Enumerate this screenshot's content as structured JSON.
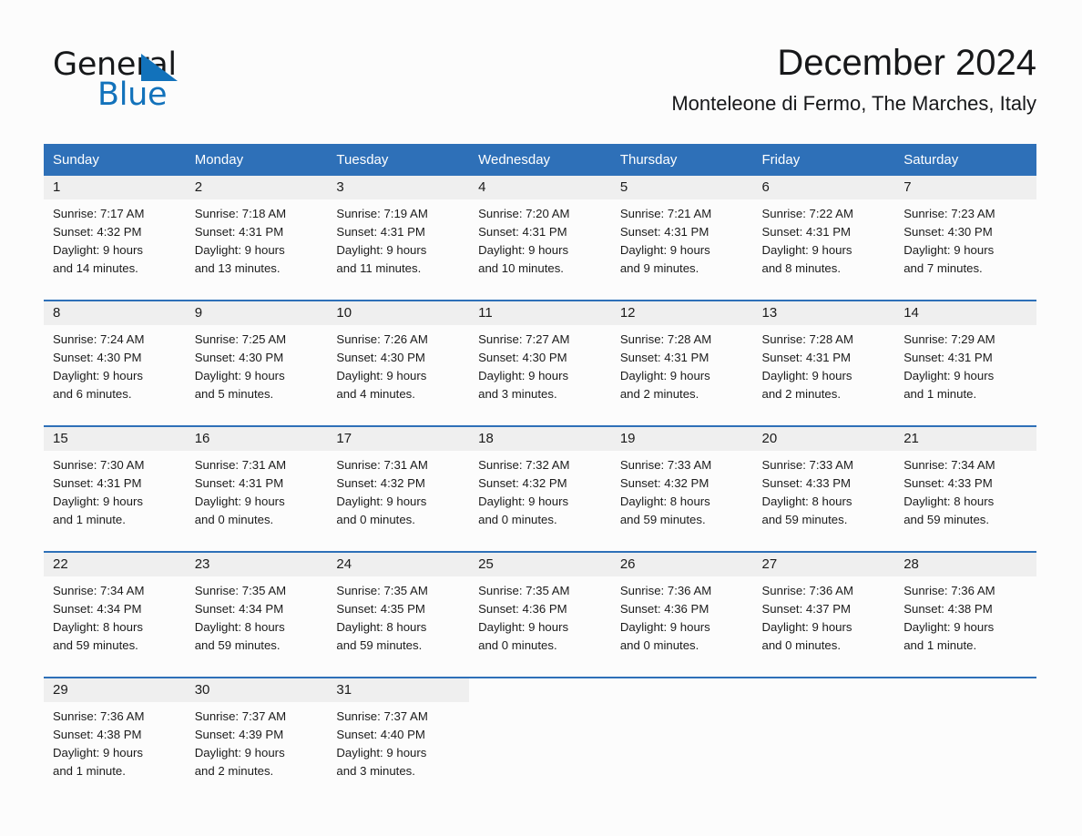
{
  "brand": {
    "name_top": "General",
    "name_bottom": "Blue",
    "triangle_color": "#1272bb",
    "text_color": "#16181a"
  },
  "header": {
    "title": "December 2024",
    "subtitle": "Monteleone di Fermo, The Marches, Italy"
  },
  "colors": {
    "header_blue": "#2e70b8",
    "daynum_band": "#efefef",
    "page_background": "#fcfcfc",
    "text": "#1b1b1b"
  },
  "weekday_headers": [
    "Sunday",
    "Monday",
    "Tuesday",
    "Wednesday",
    "Thursday",
    "Friday",
    "Saturday"
  ],
  "weeks": [
    [
      {
        "day": "1",
        "sunrise": "Sunrise: 7:17 AM",
        "sunset": "Sunset: 4:32 PM",
        "daylight1": "Daylight: 9 hours",
        "daylight2": "and 14 minutes."
      },
      {
        "day": "2",
        "sunrise": "Sunrise: 7:18 AM",
        "sunset": "Sunset: 4:31 PM",
        "daylight1": "Daylight: 9 hours",
        "daylight2": "and 13 minutes."
      },
      {
        "day": "3",
        "sunrise": "Sunrise: 7:19 AM",
        "sunset": "Sunset: 4:31 PM",
        "daylight1": "Daylight: 9 hours",
        "daylight2": "and 11 minutes."
      },
      {
        "day": "4",
        "sunrise": "Sunrise: 7:20 AM",
        "sunset": "Sunset: 4:31 PM",
        "daylight1": "Daylight: 9 hours",
        "daylight2": "and 10 minutes."
      },
      {
        "day": "5",
        "sunrise": "Sunrise: 7:21 AM",
        "sunset": "Sunset: 4:31 PM",
        "daylight1": "Daylight: 9 hours",
        "daylight2": "and 9 minutes."
      },
      {
        "day": "6",
        "sunrise": "Sunrise: 7:22 AM",
        "sunset": "Sunset: 4:31 PM",
        "daylight1": "Daylight: 9 hours",
        "daylight2": "and 8 minutes."
      },
      {
        "day": "7",
        "sunrise": "Sunrise: 7:23 AM",
        "sunset": "Sunset: 4:30 PM",
        "daylight1": "Daylight: 9 hours",
        "daylight2": "and 7 minutes."
      }
    ],
    [
      {
        "day": "8",
        "sunrise": "Sunrise: 7:24 AM",
        "sunset": "Sunset: 4:30 PM",
        "daylight1": "Daylight: 9 hours",
        "daylight2": "and 6 minutes."
      },
      {
        "day": "9",
        "sunrise": "Sunrise: 7:25 AM",
        "sunset": "Sunset: 4:30 PM",
        "daylight1": "Daylight: 9 hours",
        "daylight2": "and 5 minutes."
      },
      {
        "day": "10",
        "sunrise": "Sunrise: 7:26 AM",
        "sunset": "Sunset: 4:30 PM",
        "daylight1": "Daylight: 9 hours",
        "daylight2": "and 4 minutes."
      },
      {
        "day": "11",
        "sunrise": "Sunrise: 7:27 AM",
        "sunset": "Sunset: 4:30 PM",
        "daylight1": "Daylight: 9 hours",
        "daylight2": "and 3 minutes."
      },
      {
        "day": "12",
        "sunrise": "Sunrise: 7:28 AM",
        "sunset": "Sunset: 4:31 PM",
        "daylight1": "Daylight: 9 hours",
        "daylight2": "and 2 minutes."
      },
      {
        "day": "13",
        "sunrise": "Sunrise: 7:28 AM",
        "sunset": "Sunset: 4:31 PM",
        "daylight1": "Daylight: 9 hours",
        "daylight2": "and 2 minutes."
      },
      {
        "day": "14",
        "sunrise": "Sunrise: 7:29 AM",
        "sunset": "Sunset: 4:31 PM",
        "daylight1": "Daylight: 9 hours",
        "daylight2": "and 1 minute."
      }
    ],
    [
      {
        "day": "15",
        "sunrise": "Sunrise: 7:30 AM",
        "sunset": "Sunset: 4:31 PM",
        "daylight1": "Daylight: 9 hours",
        "daylight2": "and 1 minute."
      },
      {
        "day": "16",
        "sunrise": "Sunrise: 7:31 AM",
        "sunset": "Sunset: 4:31 PM",
        "daylight1": "Daylight: 9 hours",
        "daylight2": "and 0 minutes."
      },
      {
        "day": "17",
        "sunrise": "Sunrise: 7:31 AM",
        "sunset": "Sunset: 4:32 PM",
        "daylight1": "Daylight: 9 hours",
        "daylight2": "and 0 minutes."
      },
      {
        "day": "18",
        "sunrise": "Sunrise: 7:32 AM",
        "sunset": "Sunset: 4:32 PM",
        "daylight1": "Daylight: 9 hours",
        "daylight2": "and 0 minutes."
      },
      {
        "day": "19",
        "sunrise": "Sunrise: 7:33 AM",
        "sunset": "Sunset: 4:32 PM",
        "daylight1": "Daylight: 8 hours",
        "daylight2": "and 59 minutes."
      },
      {
        "day": "20",
        "sunrise": "Sunrise: 7:33 AM",
        "sunset": "Sunset: 4:33 PM",
        "daylight1": "Daylight: 8 hours",
        "daylight2": "and 59 minutes."
      },
      {
        "day": "21",
        "sunrise": "Sunrise: 7:34 AM",
        "sunset": "Sunset: 4:33 PM",
        "daylight1": "Daylight: 8 hours",
        "daylight2": "and 59 minutes."
      }
    ],
    [
      {
        "day": "22",
        "sunrise": "Sunrise: 7:34 AM",
        "sunset": "Sunset: 4:34 PM",
        "daylight1": "Daylight: 8 hours",
        "daylight2": "and 59 minutes."
      },
      {
        "day": "23",
        "sunrise": "Sunrise: 7:35 AM",
        "sunset": "Sunset: 4:34 PM",
        "daylight1": "Daylight: 8 hours",
        "daylight2": "and 59 minutes."
      },
      {
        "day": "24",
        "sunrise": "Sunrise: 7:35 AM",
        "sunset": "Sunset: 4:35 PM",
        "daylight1": "Daylight: 8 hours",
        "daylight2": "and 59 minutes."
      },
      {
        "day": "25",
        "sunrise": "Sunrise: 7:35 AM",
        "sunset": "Sunset: 4:36 PM",
        "daylight1": "Daylight: 9 hours",
        "daylight2": "and 0 minutes."
      },
      {
        "day": "26",
        "sunrise": "Sunrise: 7:36 AM",
        "sunset": "Sunset: 4:36 PM",
        "daylight1": "Daylight: 9 hours",
        "daylight2": "and 0 minutes."
      },
      {
        "day": "27",
        "sunrise": "Sunrise: 7:36 AM",
        "sunset": "Sunset: 4:37 PM",
        "daylight1": "Daylight: 9 hours",
        "daylight2": "and 0 minutes."
      },
      {
        "day": "28",
        "sunrise": "Sunrise: 7:36 AM",
        "sunset": "Sunset: 4:38 PM",
        "daylight1": "Daylight: 9 hours",
        "daylight2": "and 1 minute."
      }
    ],
    [
      {
        "day": "29",
        "sunrise": "Sunrise: 7:36 AM",
        "sunset": "Sunset: 4:38 PM",
        "daylight1": "Daylight: 9 hours",
        "daylight2": "and 1 minute."
      },
      {
        "day": "30",
        "sunrise": "Sunrise: 7:37 AM",
        "sunset": "Sunset: 4:39 PM",
        "daylight1": "Daylight: 9 hours",
        "daylight2": "and 2 minutes."
      },
      {
        "day": "31",
        "sunrise": "Sunrise: 7:37 AM",
        "sunset": "Sunset: 4:40 PM",
        "daylight1": "Daylight: 9 hours",
        "daylight2": "and 3 minutes."
      },
      {
        "day": "",
        "sunrise": "",
        "sunset": "",
        "daylight1": "",
        "daylight2": ""
      },
      {
        "day": "",
        "sunrise": "",
        "sunset": "",
        "daylight1": "",
        "daylight2": ""
      },
      {
        "day": "",
        "sunrise": "",
        "sunset": "",
        "daylight1": "",
        "daylight2": ""
      },
      {
        "day": "",
        "sunrise": "",
        "sunset": "",
        "daylight1": "",
        "daylight2": ""
      }
    ]
  ]
}
